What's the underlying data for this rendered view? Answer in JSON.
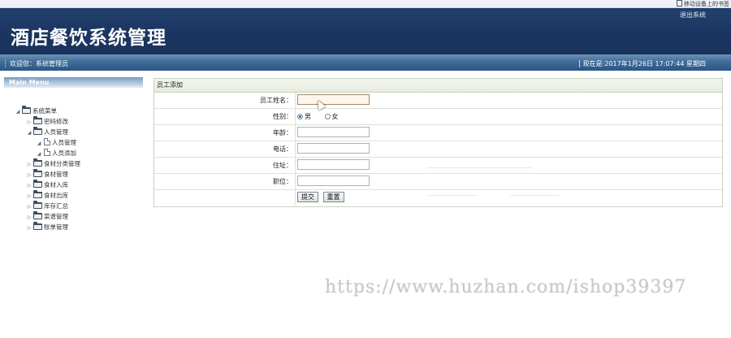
{
  "browser": {
    "bookmark_text": "移动设备上的书签"
  },
  "header": {
    "title": "酒店餐饮系统管理",
    "logout_label": "退出系统"
  },
  "status": {
    "welcome": "欢迎您：系统管理员",
    "datetime": "现在是:2017年1月26日 17:07:44 星期四"
  },
  "menu": {
    "heading": "Main Menu",
    "items": [
      {
        "label": "系统菜单",
        "level": 0,
        "expanded": true,
        "icon": "folder-icon"
      },
      {
        "label": "密码修改",
        "level": 1,
        "expanded": false,
        "icon": "folder-icon"
      },
      {
        "label": "人员管理",
        "level": 1,
        "expanded": true,
        "icon": "folder-icon"
      },
      {
        "label": "人员管理",
        "level": 2,
        "expanded": false,
        "icon": "page-icon"
      },
      {
        "label": "人员添加",
        "level": 2,
        "expanded": false,
        "icon": "page-icon"
      },
      {
        "label": "食材分类管理",
        "level": 1,
        "expanded": false,
        "icon": "folder-icon"
      },
      {
        "label": "食材管理",
        "level": 1,
        "expanded": false,
        "icon": "folder-icon"
      },
      {
        "label": "食材入库",
        "level": 1,
        "expanded": false,
        "icon": "folder-icon"
      },
      {
        "label": "食材出库",
        "level": 1,
        "expanded": false,
        "icon": "folder-icon"
      },
      {
        "label": "库存汇总",
        "level": 1,
        "expanded": false,
        "icon": "folder-icon"
      },
      {
        "label": "菜谱管理",
        "level": 1,
        "expanded": false,
        "icon": "folder-icon"
      },
      {
        "label": "账单管理",
        "level": 1,
        "expanded": false,
        "icon": "folder-icon"
      }
    ]
  },
  "form": {
    "title": "员工添加",
    "fields": {
      "name_label": "员工姓名：",
      "gender_label": "性别：",
      "gender_male": "男",
      "gender_female": "女",
      "gender_selected": "男",
      "age_label": "年龄：",
      "phone_label": "电话：",
      "address_label": "住址：",
      "position_label": "职位："
    },
    "buttons": {
      "submit": "提交",
      "reset": "重置"
    }
  },
  "watermark": "https://www.huzhan.com/ishop39397",
  "colors": {
    "banner": "#1b3561",
    "statusbar": "#3f6c98",
    "panel_header": "#e7ecdf"
  }
}
